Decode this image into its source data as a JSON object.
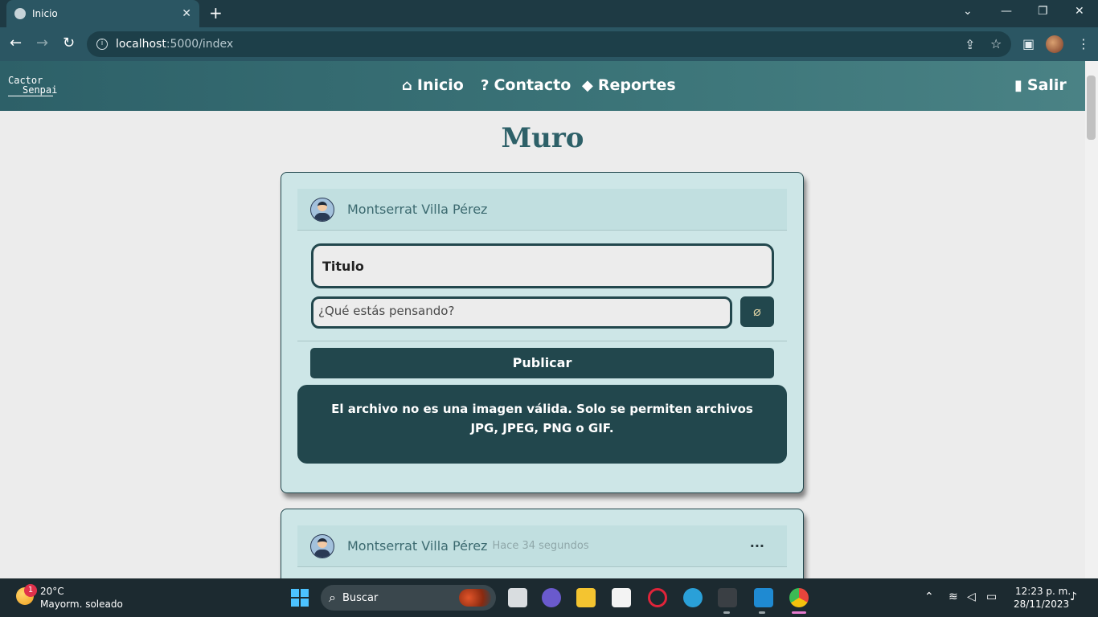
{
  "browser": {
    "tab_title": "Inicio",
    "tab_close": "✕",
    "new_tab": "+",
    "url_host": "localhost",
    "url_path": ":5000/index"
  },
  "site": {
    "logo_line1": "Cactor",
    "logo_line2": "Senpai",
    "nav": [
      {
        "label": "Inicio",
        "icon": "home-icon"
      },
      {
        "label": "Contacto",
        "icon": "question-icon"
      },
      {
        "label": "Reportes",
        "icon": "warning-icon"
      }
    ],
    "logout_label": "Salir",
    "page_title": "Muro"
  },
  "composer": {
    "user_name": "Montserrat Villa Pérez",
    "title_value": "Titulo",
    "text_placeholder": "¿Qué estás pensando?",
    "publish_label": "Publicar",
    "alert_text": "El archivo no es una imagen válida. Solo se permiten archivos JPG, JPEG, PNG o GIF."
  },
  "post": {
    "user_name": "Montserrat Villa Pérez",
    "time": "Hace 34 segundos",
    "menu": "···"
  },
  "taskbar": {
    "weather_badge": "1",
    "temperature": "20°C",
    "weather_desc": "Mayorm. soleado",
    "search_label": "Buscar",
    "time": "12:23 p. m.",
    "date": "28/11/2023"
  },
  "colors": {
    "brand_dark": "#22474d",
    "card_bg": "#cde6e7",
    "nav_bg": "#3c7579"
  }
}
